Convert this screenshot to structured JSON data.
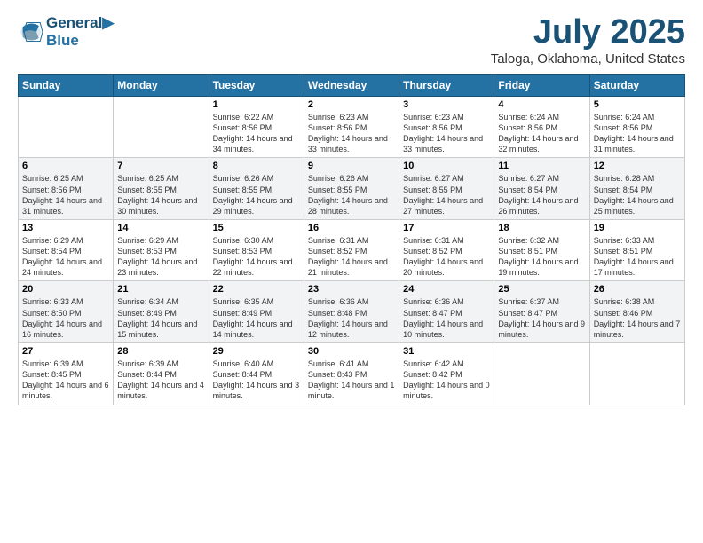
{
  "logo": {
    "line1": "General",
    "line2": "Blue"
  },
  "title": "July 2025",
  "location": "Taloga, Oklahoma, United States",
  "days_of_week": [
    "Sunday",
    "Monday",
    "Tuesday",
    "Wednesday",
    "Thursday",
    "Friday",
    "Saturday"
  ],
  "weeks": [
    [
      {
        "day": "",
        "sunrise": "",
        "sunset": "",
        "daylight": ""
      },
      {
        "day": "",
        "sunrise": "",
        "sunset": "",
        "daylight": ""
      },
      {
        "day": "1",
        "sunrise": "Sunrise: 6:22 AM",
        "sunset": "Sunset: 8:56 PM",
        "daylight": "Daylight: 14 hours and 34 minutes."
      },
      {
        "day": "2",
        "sunrise": "Sunrise: 6:23 AM",
        "sunset": "Sunset: 8:56 PM",
        "daylight": "Daylight: 14 hours and 33 minutes."
      },
      {
        "day": "3",
        "sunrise": "Sunrise: 6:23 AM",
        "sunset": "Sunset: 8:56 PM",
        "daylight": "Daylight: 14 hours and 33 minutes."
      },
      {
        "day": "4",
        "sunrise": "Sunrise: 6:24 AM",
        "sunset": "Sunset: 8:56 PM",
        "daylight": "Daylight: 14 hours and 32 minutes."
      },
      {
        "day": "5",
        "sunrise": "Sunrise: 6:24 AM",
        "sunset": "Sunset: 8:56 PM",
        "daylight": "Daylight: 14 hours and 31 minutes."
      }
    ],
    [
      {
        "day": "6",
        "sunrise": "Sunrise: 6:25 AM",
        "sunset": "Sunset: 8:56 PM",
        "daylight": "Daylight: 14 hours and 31 minutes."
      },
      {
        "day": "7",
        "sunrise": "Sunrise: 6:25 AM",
        "sunset": "Sunset: 8:55 PM",
        "daylight": "Daylight: 14 hours and 30 minutes."
      },
      {
        "day": "8",
        "sunrise": "Sunrise: 6:26 AM",
        "sunset": "Sunset: 8:55 PM",
        "daylight": "Daylight: 14 hours and 29 minutes."
      },
      {
        "day": "9",
        "sunrise": "Sunrise: 6:26 AM",
        "sunset": "Sunset: 8:55 PM",
        "daylight": "Daylight: 14 hours and 28 minutes."
      },
      {
        "day": "10",
        "sunrise": "Sunrise: 6:27 AM",
        "sunset": "Sunset: 8:55 PM",
        "daylight": "Daylight: 14 hours and 27 minutes."
      },
      {
        "day": "11",
        "sunrise": "Sunrise: 6:27 AM",
        "sunset": "Sunset: 8:54 PM",
        "daylight": "Daylight: 14 hours and 26 minutes."
      },
      {
        "day": "12",
        "sunrise": "Sunrise: 6:28 AM",
        "sunset": "Sunset: 8:54 PM",
        "daylight": "Daylight: 14 hours and 25 minutes."
      }
    ],
    [
      {
        "day": "13",
        "sunrise": "Sunrise: 6:29 AM",
        "sunset": "Sunset: 8:54 PM",
        "daylight": "Daylight: 14 hours and 24 minutes."
      },
      {
        "day": "14",
        "sunrise": "Sunrise: 6:29 AM",
        "sunset": "Sunset: 8:53 PM",
        "daylight": "Daylight: 14 hours and 23 minutes."
      },
      {
        "day": "15",
        "sunrise": "Sunrise: 6:30 AM",
        "sunset": "Sunset: 8:53 PM",
        "daylight": "Daylight: 14 hours and 22 minutes."
      },
      {
        "day": "16",
        "sunrise": "Sunrise: 6:31 AM",
        "sunset": "Sunset: 8:52 PM",
        "daylight": "Daylight: 14 hours and 21 minutes."
      },
      {
        "day": "17",
        "sunrise": "Sunrise: 6:31 AM",
        "sunset": "Sunset: 8:52 PM",
        "daylight": "Daylight: 14 hours and 20 minutes."
      },
      {
        "day": "18",
        "sunrise": "Sunrise: 6:32 AM",
        "sunset": "Sunset: 8:51 PM",
        "daylight": "Daylight: 14 hours and 19 minutes."
      },
      {
        "day": "19",
        "sunrise": "Sunrise: 6:33 AM",
        "sunset": "Sunset: 8:51 PM",
        "daylight": "Daylight: 14 hours and 17 minutes."
      }
    ],
    [
      {
        "day": "20",
        "sunrise": "Sunrise: 6:33 AM",
        "sunset": "Sunset: 8:50 PM",
        "daylight": "Daylight: 14 hours and 16 minutes."
      },
      {
        "day": "21",
        "sunrise": "Sunrise: 6:34 AM",
        "sunset": "Sunset: 8:49 PM",
        "daylight": "Daylight: 14 hours and 15 minutes."
      },
      {
        "day": "22",
        "sunrise": "Sunrise: 6:35 AM",
        "sunset": "Sunset: 8:49 PM",
        "daylight": "Daylight: 14 hours and 14 minutes."
      },
      {
        "day": "23",
        "sunrise": "Sunrise: 6:36 AM",
        "sunset": "Sunset: 8:48 PM",
        "daylight": "Daylight: 14 hours and 12 minutes."
      },
      {
        "day": "24",
        "sunrise": "Sunrise: 6:36 AM",
        "sunset": "Sunset: 8:47 PM",
        "daylight": "Daylight: 14 hours and 10 minutes."
      },
      {
        "day": "25",
        "sunrise": "Sunrise: 6:37 AM",
        "sunset": "Sunset: 8:47 PM",
        "daylight": "Daylight: 14 hours and 9 minutes."
      },
      {
        "day": "26",
        "sunrise": "Sunrise: 6:38 AM",
        "sunset": "Sunset: 8:46 PM",
        "daylight": "Daylight: 14 hours and 7 minutes."
      }
    ],
    [
      {
        "day": "27",
        "sunrise": "Sunrise: 6:39 AM",
        "sunset": "Sunset: 8:45 PM",
        "daylight": "Daylight: 14 hours and 6 minutes."
      },
      {
        "day": "28",
        "sunrise": "Sunrise: 6:39 AM",
        "sunset": "Sunset: 8:44 PM",
        "daylight": "Daylight: 14 hours and 4 minutes."
      },
      {
        "day": "29",
        "sunrise": "Sunrise: 6:40 AM",
        "sunset": "Sunset: 8:44 PM",
        "daylight": "Daylight: 14 hours and 3 minutes."
      },
      {
        "day": "30",
        "sunrise": "Sunrise: 6:41 AM",
        "sunset": "Sunset: 8:43 PM",
        "daylight": "Daylight: 14 hours and 1 minute."
      },
      {
        "day": "31",
        "sunrise": "Sunrise: 6:42 AM",
        "sunset": "Sunset: 8:42 PM",
        "daylight": "Daylight: 14 hours and 0 minutes."
      },
      {
        "day": "",
        "sunrise": "",
        "sunset": "",
        "daylight": ""
      },
      {
        "day": "",
        "sunrise": "",
        "sunset": "",
        "daylight": ""
      }
    ]
  ]
}
